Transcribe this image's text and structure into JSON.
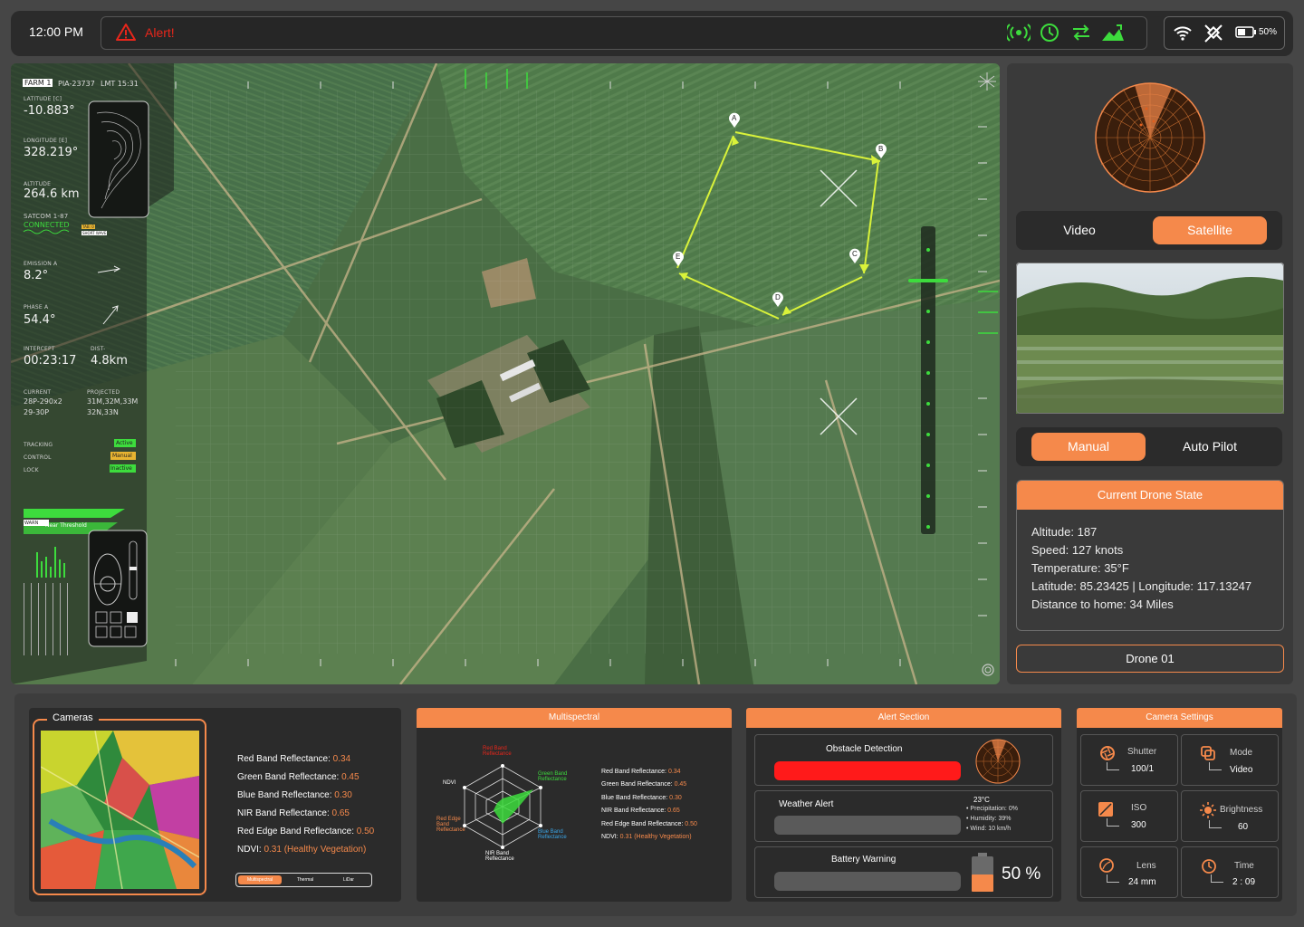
{
  "topbar": {
    "time": "12:00 PM",
    "alert": "Alert!",
    "battery": "50%"
  },
  "hud": {
    "farm_tag": "FARM 1",
    "mission": "PIA-23737",
    "lmt": "LMT 15:31",
    "lat_label": "LATITUDE [C]",
    "lat_val": "-10.883°",
    "lon_label": "LONGITUDE [E]",
    "lon_val": "328.219°",
    "alt_label": "ALTITUDE",
    "alt_val": "264.6 km",
    "satcom": "SATCOM 1-87",
    "connected": "CONNECTED",
    "chip1": "TAB: 0",
    "chip2": "SHORT WAVE",
    "emission_label": "EMISSION A",
    "emission_val": "8.2°",
    "phase_label": "PHASE A",
    "phase_val": "54.4°",
    "intercept_label": "INTERCEPT",
    "intercept_val": "00:23:17",
    "dist_label": "DIST-",
    "dist_val": "4.8km",
    "current_label": "CURRENT",
    "current_val1": "28P-290x2",
    "current_val2": "29-30P",
    "projected_label": "PROJECTED",
    "projected_val1": "31M,32M,33M",
    "projected_val2": "32N,33N",
    "tracking": "TRACKING",
    "tracking_status": "Active",
    "control": "CONTROL",
    "control_status": "Manual",
    "lock": "LOCK",
    "lock_status": "Inactive",
    "warn": "WARN",
    "warn_text": "Near Threshold",
    "waypoints": [
      "A",
      "B",
      "C",
      "D",
      "E"
    ]
  },
  "view_toggle": {
    "video": "Video",
    "satellite": "Satellite"
  },
  "mode_toggle": {
    "manual": "Manual",
    "autopilot": "Auto Pilot"
  },
  "drone_state": {
    "title": "Current Drone State",
    "altitude": "Altitude: 187",
    "speed": "Speed: 127 knots",
    "temperature": "Temperature: 35°F",
    "coords": "Latitude: 85.23425 | Longitude: 117.13247",
    "distance": "Distance to home: 34 Miles"
  },
  "drone_name": "Drone 01",
  "cameras": {
    "title": "Cameras",
    "lines": [
      {
        "label": "Red Band Reflectance:",
        "value": "0.34"
      },
      {
        "label": "Green Band Reflectance:",
        "value": "0.45"
      },
      {
        "label": "Blue Band Reflectance:",
        "value": "0.30"
      },
      {
        "label": "NIR Band Reflectance:",
        "value": "0.65"
      },
      {
        "label": "Red Edge Band Reflectance:",
        "value": "0.50"
      },
      {
        "label": "NDVI:",
        "value": "0.31 (Healthy Vegetation)"
      }
    ],
    "tabs": [
      "Multispectral",
      "Thermal",
      "LiDar"
    ]
  },
  "multispectral": {
    "title": "Multispectral",
    "axes": {
      "red": "Red Band Reflectance",
      "green": "Green Band Reflectance",
      "blue": "Blue Band Reflectance",
      "nir": "NIR Band Reflectance",
      "rededge": "Red Edge Band Reflectance",
      "ndvi": "NDVI"
    },
    "lines": [
      {
        "label": "Red Band Reflectance:",
        "value": "0.34"
      },
      {
        "label": "Green Band Reflectance:",
        "value": "0.45"
      },
      {
        "label": "Blue Band Reflectance:",
        "value": "0.30"
      },
      {
        "label": "NIR Band Reflectance:",
        "value": "0.65"
      },
      {
        "label": "Red Edge Band Reflectance:",
        "value": "0.50"
      },
      {
        "label": "NDVI:",
        "value": "0.31 (Healthy Vegetation)"
      }
    ]
  },
  "alerts": {
    "title": "Alert Section",
    "obstacle": "Obstacle Detection",
    "weather": "Weather Alert",
    "weather_temp": "23°C",
    "weather_lines": [
      "Precipitation: 0%",
      "Humidity: 39%",
      "Wind: 10 km/h"
    ],
    "battery": "Battery Warning",
    "battery_pct": "50 %"
  },
  "camera_settings": {
    "title": "Camera Settings",
    "shutter_label": "Shutter",
    "shutter_val": "100/1",
    "mode_label": "Mode",
    "mode_val": "Video",
    "iso_label": "ISO",
    "iso_val": "300",
    "brightness_label": "Brightness",
    "brightness_val": "60",
    "lens_label": "Lens",
    "lens_val": "24 mm",
    "time_label": "Time",
    "time_val": "2 : 09"
  },
  "colors": {
    "accent": "#f5894b",
    "alert": "#e8261b",
    "hud_green": "#3ddc3d",
    "path": "#d9f23a"
  }
}
